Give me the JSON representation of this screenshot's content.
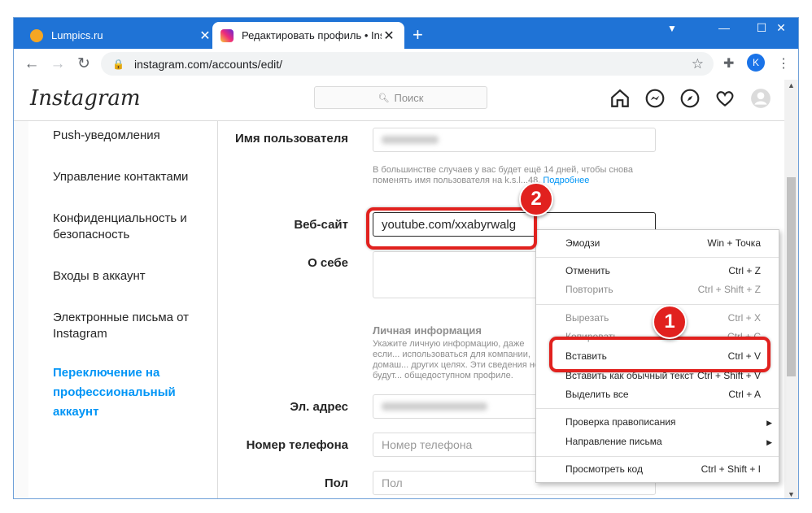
{
  "browser": {
    "tabs": [
      {
        "title": "Lumpics.ru",
        "active": false
      },
      {
        "title": "Редактировать профиль • Instag",
        "active": true
      }
    ],
    "new_tab": "+",
    "url": "instagram.com/accounts/edit/",
    "profile_letter": "K",
    "window_controls": {
      "minimize": "—",
      "maximize": "☐",
      "close": "✕"
    }
  },
  "instagram": {
    "logo": "Instagram",
    "search_placeholder": "Поиск",
    "sidebar": [
      "Push-уведомления",
      "Управление контактами",
      "Конфиденциальность и безопасность",
      "Входы в аккаунт",
      "Электронные письма от Instagram",
      "Переключение на профессиональный аккаунт"
    ],
    "form": {
      "username_label": "Имя пользователя",
      "username_hint": "В большинстве случаев у вас будет ещё 14 дней, чтобы снова поменять имя пользователя на k.s.l...48.",
      "username_hint_link": "Подробнее",
      "website_label": "Веб-сайт",
      "website_value": "youtube.com/xxabyrwalg",
      "bio_label": "О себе",
      "personal_info_title": "Личная информация",
      "personal_info_text": "Укажите личную информацию, даже если... использоваться для компании, домаш... других целях. Эти сведения не будут... общедоступном профиле.",
      "email_label": "Эл. адрес",
      "phone_label": "Номер телефона",
      "phone_placeholder": "Номер телефона",
      "gender_label": "Пол",
      "gender_placeholder": "Пол"
    }
  },
  "context_menu": {
    "items": [
      {
        "label": "Эмодзи",
        "shortcut": "Win + Точка",
        "disabled": false
      },
      {
        "label": "Отменить",
        "shortcut": "Ctrl + Z",
        "disabled": false
      },
      {
        "label": "Повторить",
        "shortcut": "Ctrl + Shift + Z",
        "disabled": true
      },
      {
        "label": "Вырезать",
        "shortcut": "Ctrl + X",
        "disabled": true
      },
      {
        "label": "Копировать",
        "shortcut": "Ctrl + C",
        "disabled": true
      },
      {
        "label": "Вставить",
        "shortcut": "Ctrl + V",
        "disabled": false
      },
      {
        "label": "Вставить как обычный текст",
        "shortcut": "Ctrl + Shift + V",
        "disabled": false
      },
      {
        "label": "Выделить все",
        "shortcut": "Ctrl + A",
        "disabled": false
      },
      {
        "label": "Проверка правописания",
        "shortcut": "",
        "disabled": false
      },
      {
        "label": "Направление письма",
        "shortcut": "",
        "disabled": false
      },
      {
        "label": "Просмотреть код",
        "shortcut": "Ctrl + Shift + I",
        "disabled": false
      }
    ]
  },
  "annotations": {
    "badge1": "1",
    "badge2": "2",
    "color": "#e1211e"
  }
}
